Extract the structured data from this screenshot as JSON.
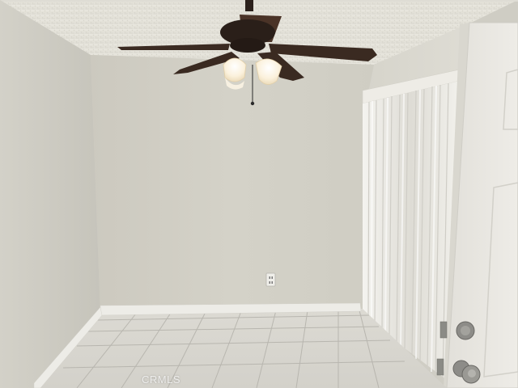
{
  "watermark": {
    "text": "CRMLS"
  },
  "colors": {
    "ceiling": "#e6e4dc",
    "back_wall": "#d2d0c6",
    "left_wall": "#c8c6bd",
    "right_wall": "#dcdad2",
    "floor_tile": "#d8d6cf",
    "grout": "#b9b7b0",
    "baseboard": "#eeede8",
    "blinds": "#eceae4",
    "door": "#e8e6e0",
    "fan_blade": "#3a2a22",
    "fan_light": "#fbf4e4"
  },
  "icons": {
    "ceiling_fan": "ceiling-fan-icon",
    "light_bulb": "light-globe-icon",
    "outlet": "outlet-icon",
    "door_knob": "door-knob-icon",
    "deadbolt": "deadbolt-icon"
  }
}
